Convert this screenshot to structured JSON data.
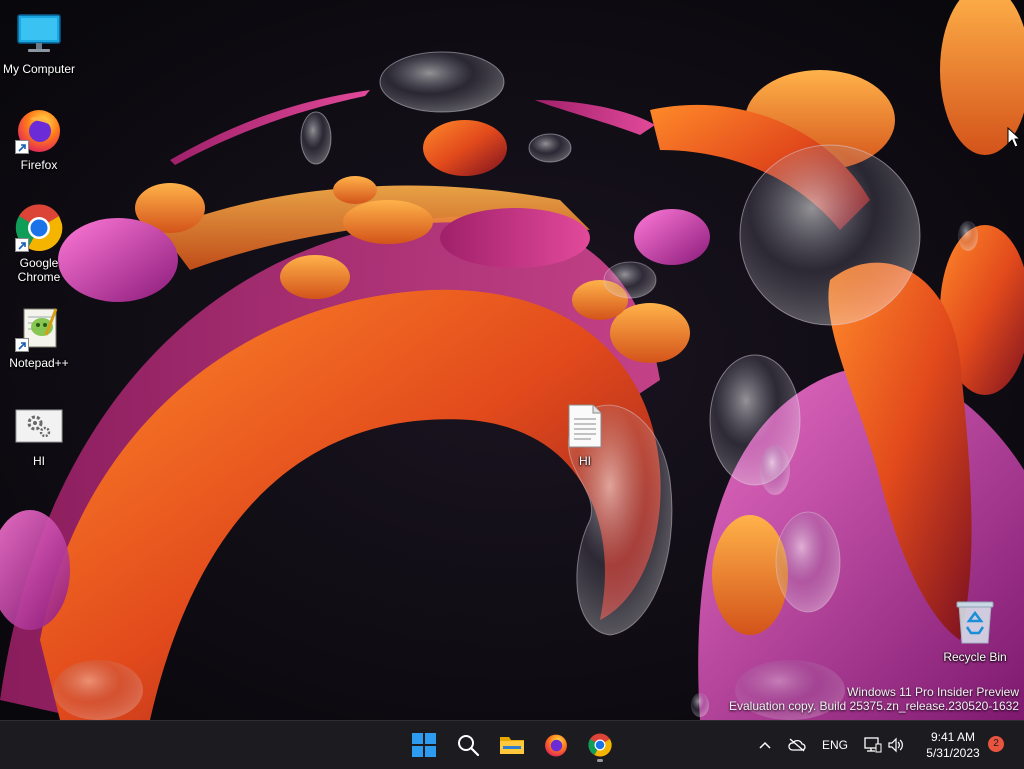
{
  "desktop_icons": [
    {
      "label": "My Computer"
    },
    {
      "label": "Firefox"
    },
    {
      "label": "Google Chrome"
    },
    {
      "label": "Notepad++"
    },
    {
      "label": "HI"
    },
    {
      "label": "HI"
    },
    {
      "label": "Recycle Bin"
    }
  ],
  "watermark": {
    "line1": "Windows 11 Pro Insider Preview",
    "line2": "Evaluation copy. Build 25375.zn_release.230520-1632"
  },
  "taskbar": {
    "apps": [
      "start-icon",
      "search-icon",
      "file-explorer-icon",
      "firefox-icon",
      "chrome-icon"
    ],
    "tray": {
      "language": "ENG",
      "time": "9:41 AM",
      "date": "5/31/2023",
      "notification_count": "2"
    }
  },
  "colors": {
    "taskbar_bg": "#1c1c20",
    "start_blue": "#2d9cf0",
    "badge": "#e8543f"
  }
}
